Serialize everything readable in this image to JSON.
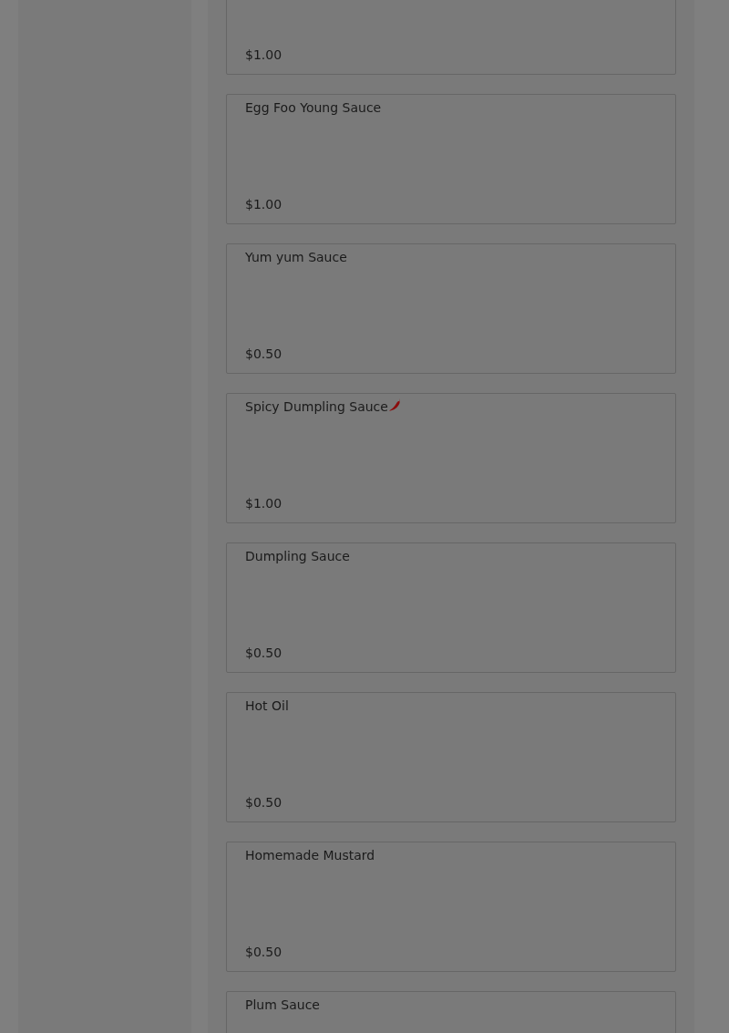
{
  "menu_items": [
    {
      "price": "$1.00"
    },
    {
      "name": "Egg Foo Young Sauce",
      "price": "$1.00",
      "spicy": false
    },
    {
      "name": "Yum yum Sauce",
      "price": "$0.50",
      "spicy": false
    },
    {
      "name": "Spicy Dumpling Sauce",
      "price": "$1.00",
      "spicy": true
    },
    {
      "name": "Dumpling Sauce",
      "price": "$0.50",
      "spicy": false
    },
    {
      "name": "Hot Oil",
      "price": "$0.50",
      "spicy": false
    },
    {
      "name": "Homemade Mustard",
      "price": "$0.50",
      "spicy": false
    },
    {
      "name": "Plum Sauce",
      "spicy": false
    }
  ]
}
